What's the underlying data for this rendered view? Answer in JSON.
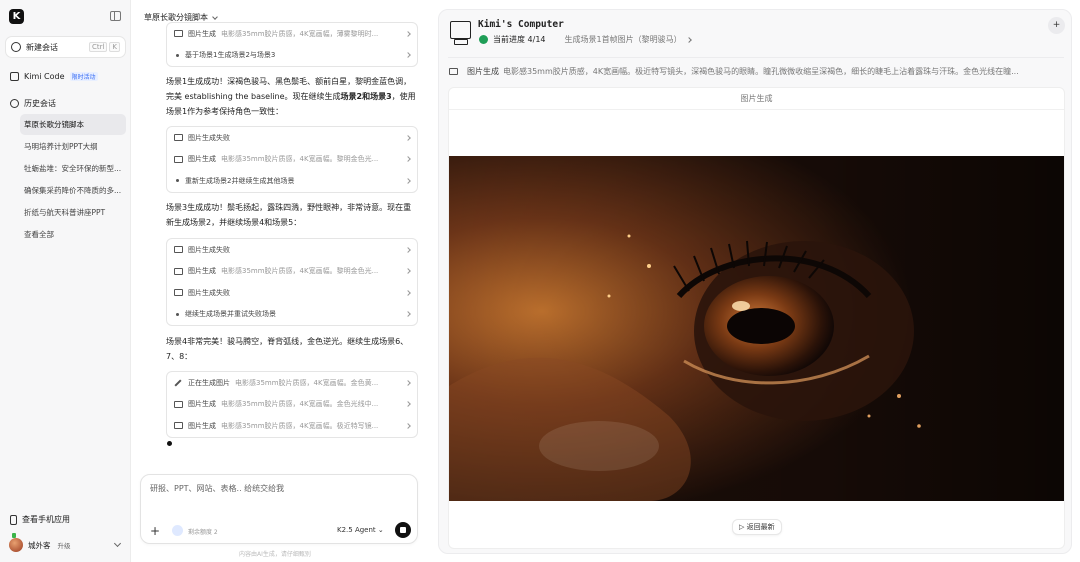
{
  "sidebar": {
    "logo": "K",
    "new_chat": "新建会话",
    "shortcut": [
      "Ctrl",
      "K"
    ],
    "kimi_code": "Kimi Code",
    "kimi_code_badge": "限时活动",
    "history": "历史会话",
    "history_items": [
      "草原长歌分镜脚本",
      "马明培养计划PPT大纲",
      "牡蛎盐堆：安全环保的新型...",
      "确保集采药降价不降质的多...",
      "折纸与航天科普讲座PPT",
      "查看全部"
    ],
    "mobile_app": "查看手机应用",
    "user_name": "城外客",
    "upgrade": "升级"
  },
  "chat": {
    "title": "草原长歌分镜脚本",
    "card0": [
      {
        "name": "图片生成",
        "desc": "电影感35mm胶片质感，4K宽画幅，薄雾黎明时..."
      },
      {
        "name": "基于场景1生成场景2与场景3",
        "desc": ""
      }
    ],
    "msg1_text": "场景1生成成功！深褐色骏马、黑色鬃毛、额前白星，黎明金蓝色调，完美 establishing the baseline。现在继续生成",
    "msg1_bold": "场景2和场景3",
    "msg1_tail": "，使用场景1作为参考保持角色一致性：",
    "card1": [
      {
        "name": "图片生成失败",
        "desc": ""
      },
      {
        "name": "图片生成",
        "desc": "电影感35mm胶片质感，4K宽画幅。黎明金色光..."
      },
      {
        "name": "重新生成场景2并继续生成其他场景",
        "desc": ""
      }
    ],
    "msg2": "场景3生成成功！鬃毛扬起，露珠四溅，野性眼神，非常诗意。现在重新生成场景2，并继续场景4和场景5：",
    "card2": [
      {
        "name": "图片生成失败",
        "desc": ""
      },
      {
        "name": "图片生成",
        "desc": "电影感35mm胶片质感，4K宽画幅。黎明金色光..."
      },
      {
        "name": "图片生成失败",
        "desc": ""
      },
      {
        "name": "继续生成场景并重试失败场景",
        "desc": ""
      }
    ],
    "msg3": "场景4非常完美！骏马腾空，脊背弧线，金色逆光。继续生成场景6、7、8：",
    "card3": [
      {
        "name": "正在生成图片",
        "desc": "电影感35mm胶片质感，4K宽画幅。金色黄..."
      },
      {
        "name": "图片生成",
        "desc": "电影感35mm胶片质感，4K宽画幅。金色光线中..."
      },
      {
        "name": "图片生成",
        "desc": "电影感35mm胶片质感，4K宽画幅。极近特写镜..."
      }
    ],
    "input_placeholder": "研报、PPT、网站、表格.. 给统交给我",
    "remaining": "剩余额度 2",
    "agent": "K2.5 Agent",
    "footer_note": "内容由AI生成，请仔细甄别"
  },
  "panel": {
    "title": "Kimi's Computer",
    "progress": "当前进度 4/14",
    "step": "生成场景1首帧图片（黎明骏马）",
    "task_name": "图片生成",
    "task_desc": "电影感35mm胶片质感，4K宽画幅。极近特写镜头，深褐色骏马的眼睛。瞳孔微微收缩呈深褐色，细长的睫毛上沾着露珠与汗珠。金色光线在瞳...",
    "viewer_title": "图片生成",
    "return_label": "返回最新"
  },
  "colors": {
    "accent_green": "#1f9e57",
    "badge_blue": "#3b6ff5",
    "send_button": "#111111"
  }
}
